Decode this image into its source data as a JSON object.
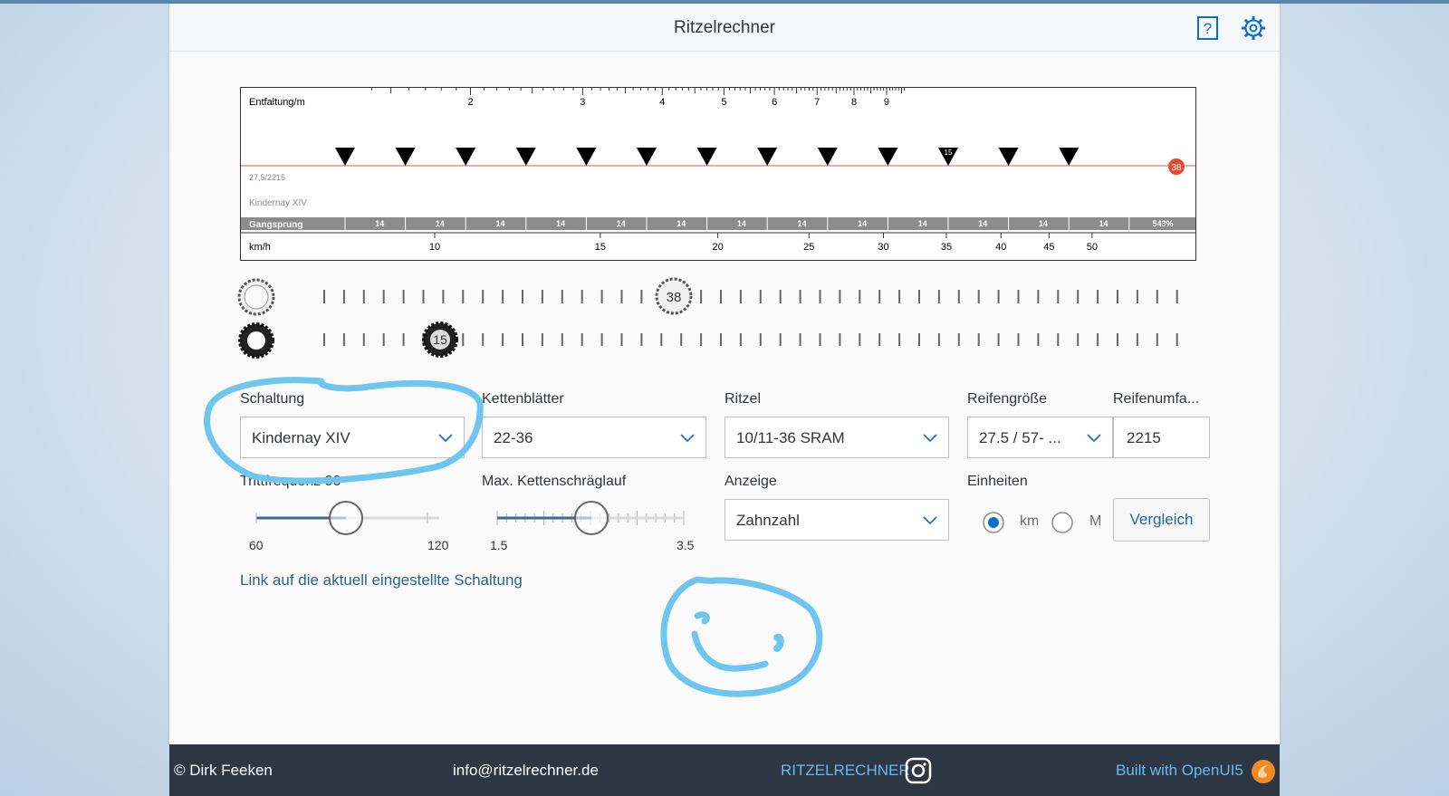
{
  "app": {
    "title": "Ritzelrechner"
  },
  "chart_data": {
    "type": "gear-ruler",
    "top_label": "Entfaltung/m",
    "top_ticks": [
      "2",
      "3",
      "4",
      "5",
      "6",
      "7",
      "8",
      "9"
    ],
    "gear_label": "27,5/2215",
    "hub_label": "Kindernay XIV",
    "step_label": "Gangsprung",
    "steps": [
      "14",
      "14",
      "14",
      "14",
      "14",
      "14",
      "14",
      "14",
      "14",
      "14",
      "14",
      "14",
      "14"
    ],
    "range": "543%",
    "current_chainring": "38",
    "current_cog": "15",
    "speed_label": "km/h",
    "speed_ticks": [
      "10",
      "15",
      "20",
      "25",
      "30",
      "35",
      "40",
      "45",
      "50"
    ]
  },
  "form": {
    "schaltung_label": "Schaltung",
    "schaltung_value": "Kindernay XIV",
    "kettenblaetter_label": "Kettenblätter",
    "kettenblaetter_value": "22-36",
    "ritzel_label": "Ritzel",
    "ritzel_value": "10/11-36 SRAM",
    "reifengroesse_label": "Reifengröße",
    "reifengroesse_value": "27.5 / 57- ...",
    "reifenumfang_label": "Reifenumfa...",
    "reifenumfang_value": "2215",
    "trittfrequenz_label": "Trittfrequenz 90",
    "trittfrequenz_min": "60",
    "trittfrequenz_max": "120",
    "trittfrequenz_value": 90,
    "kette_label": "Max. Kettenschräglauf",
    "kette_min": "1.5",
    "kette_max": "3.5",
    "kette_value": 2.5,
    "anzeige_label": "Anzeige",
    "anzeige_value": "Zahnzahl",
    "einheiten_label": "Einheiten",
    "unit_km": "km",
    "unit_m": "M",
    "vergleich_label": "Vergleich",
    "link_text": "Link auf die aktuell eingestellte Schaltung"
  },
  "footer": {
    "copyright": "© Dirk Feeken",
    "email": "info@ritzelrechner.de",
    "brand": "RITZELRECHNER",
    "built": "Built with OpenUI5"
  },
  "colors": {
    "accent": "#0a6ed1",
    "highlight": "#e64a2e",
    "footer": "#2c3743",
    "marker": "#6ec6f0"
  }
}
